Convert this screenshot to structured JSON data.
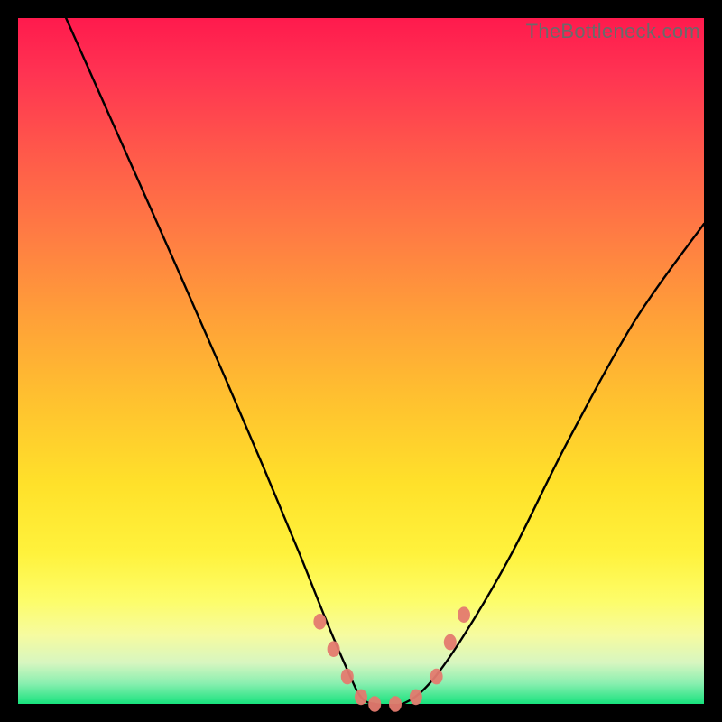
{
  "watermark": "TheBottleneck.com",
  "chart_data": {
    "type": "line",
    "title": "",
    "xlabel": "",
    "ylabel": "",
    "ylim": [
      0,
      100
    ],
    "xlim": [
      0,
      100
    ],
    "series": [
      {
        "name": "curve",
        "x": [
          7,
          15,
          23,
          30,
          36,
          41,
          45,
          48,
          50,
          52,
          56,
          60,
          65,
          72,
          80,
          90,
          100
        ],
        "y": [
          100,
          82,
          64,
          48,
          34,
          22,
          12,
          5,
          1,
          0,
          0,
          3,
          10,
          22,
          38,
          56,
          70
        ]
      }
    ],
    "markers": [
      {
        "x": 44,
        "y": 12,
        "r": 7
      },
      {
        "x": 46,
        "y": 8,
        "r": 7
      },
      {
        "x": 48,
        "y": 4,
        "r": 7
      },
      {
        "x": 50,
        "y": 1,
        "r": 7
      },
      {
        "x": 52,
        "y": 0,
        "r": 7
      },
      {
        "x": 55,
        "y": 0,
        "r": 7
      },
      {
        "x": 58,
        "y": 1,
        "r": 7
      },
      {
        "x": 61,
        "y": 4,
        "r": 7
      },
      {
        "x": 63,
        "y": 9,
        "r": 7
      },
      {
        "x": 65,
        "y": 13,
        "r": 7
      }
    ]
  }
}
